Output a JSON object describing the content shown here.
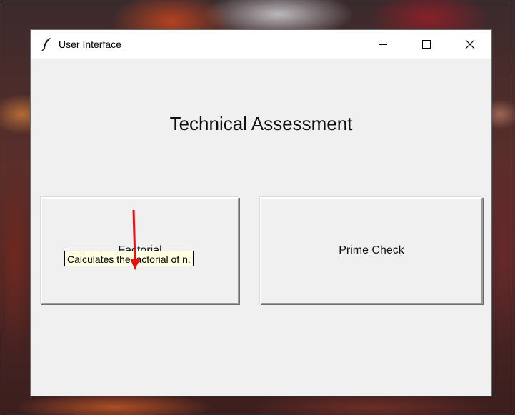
{
  "window": {
    "title": "User Interface",
    "icon": "feather-icon"
  },
  "titlebar_buttons": {
    "minimize": "minimize-icon",
    "maximize": "maximize-icon",
    "close": "close-icon"
  },
  "main": {
    "heading": "Technical Assessment",
    "buttons": [
      {
        "label": "Factorial"
      },
      {
        "label": "Prime Check"
      }
    ],
    "tooltip": "Calculates the factorial of n."
  },
  "colors": {
    "annotation_arrow": "#e81010",
    "tooltip_bg": "#ffffe1",
    "window_bg": "#f0f0f0"
  }
}
